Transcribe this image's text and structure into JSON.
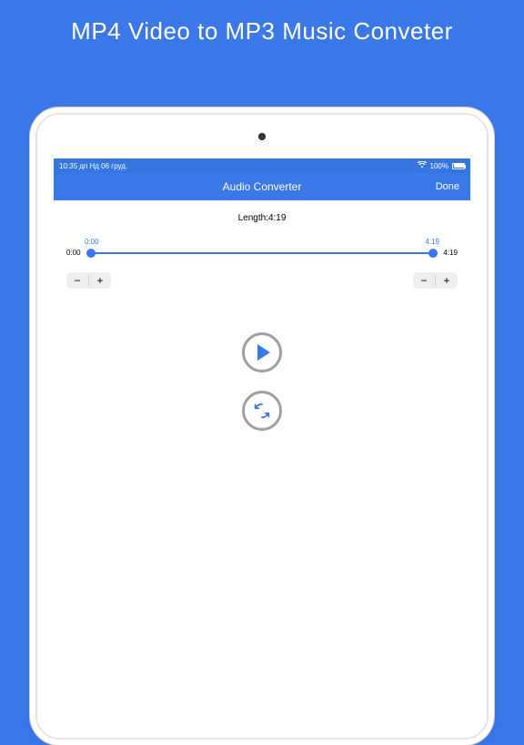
{
  "promo_title": "MP4 Video to MP3 Music Conveter",
  "status": {
    "time": "10:35 дп",
    "date": "Нд 06 груд.",
    "wifi": "wifi",
    "battery_pct": "100%"
  },
  "nav": {
    "title": "Audio Converter",
    "done": "Done"
  },
  "audio": {
    "length_label": "Length:",
    "length_value": "4:19",
    "range_start_outer": "0:00",
    "range_end_outer": "4:19",
    "handle_start_label": "0:00",
    "handle_end_label": "4:19"
  },
  "steppers": {
    "minus": "−",
    "plus": "+"
  }
}
